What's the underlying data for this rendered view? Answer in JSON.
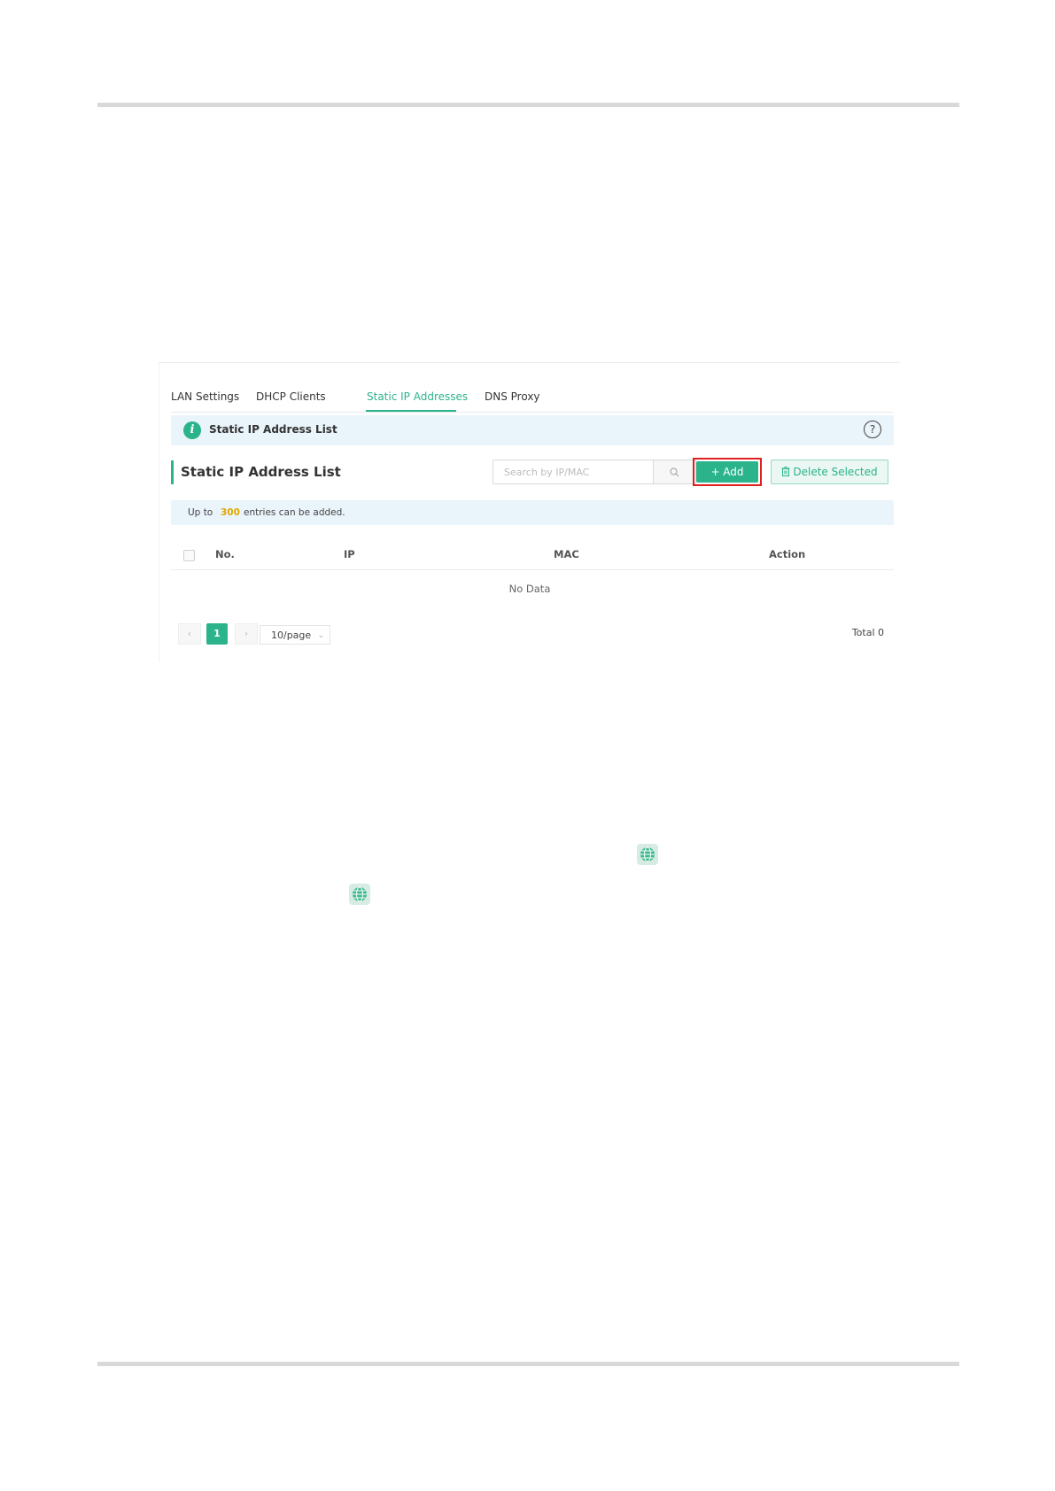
{
  "tabs": [
    {
      "label": "LAN Settings"
    },
    {
      "label": "DHCP Clients"
    },
    {
      "label": "Static IP Addresses"
    },
    {
      "label": "DNS Proxy"
    }
  ],
  "info_bar": {
    "title": "Static IP Address List"
  },
  "section": {
    "title": "Static IP Address List"
  },
  "search": {
    "placeholder": "Search by IP/MAC"
  },
  "toolbar": {
    "add_label": "+ Add",
    "delete_label": "Delete Selected"
  },
  "notice": {
    "prefix": "Up to",
    "count": "300",
    "suffix": "entries can be added."
  },
  "table": {
    "columns": [
      "No.",
      "IP",
      "MAC",
      "Action"
    ],
    "empty_text": "No Data"
  },
  "pagination": {
    "current_page": "1",
    "per_page": "10/page",
    "total": "Total 0"
  },
  "colors": {
    "accent": "#2bb38c",
    "highlight": "#e02020",
    "info_bg": "#eaf4fb"
  }
}
